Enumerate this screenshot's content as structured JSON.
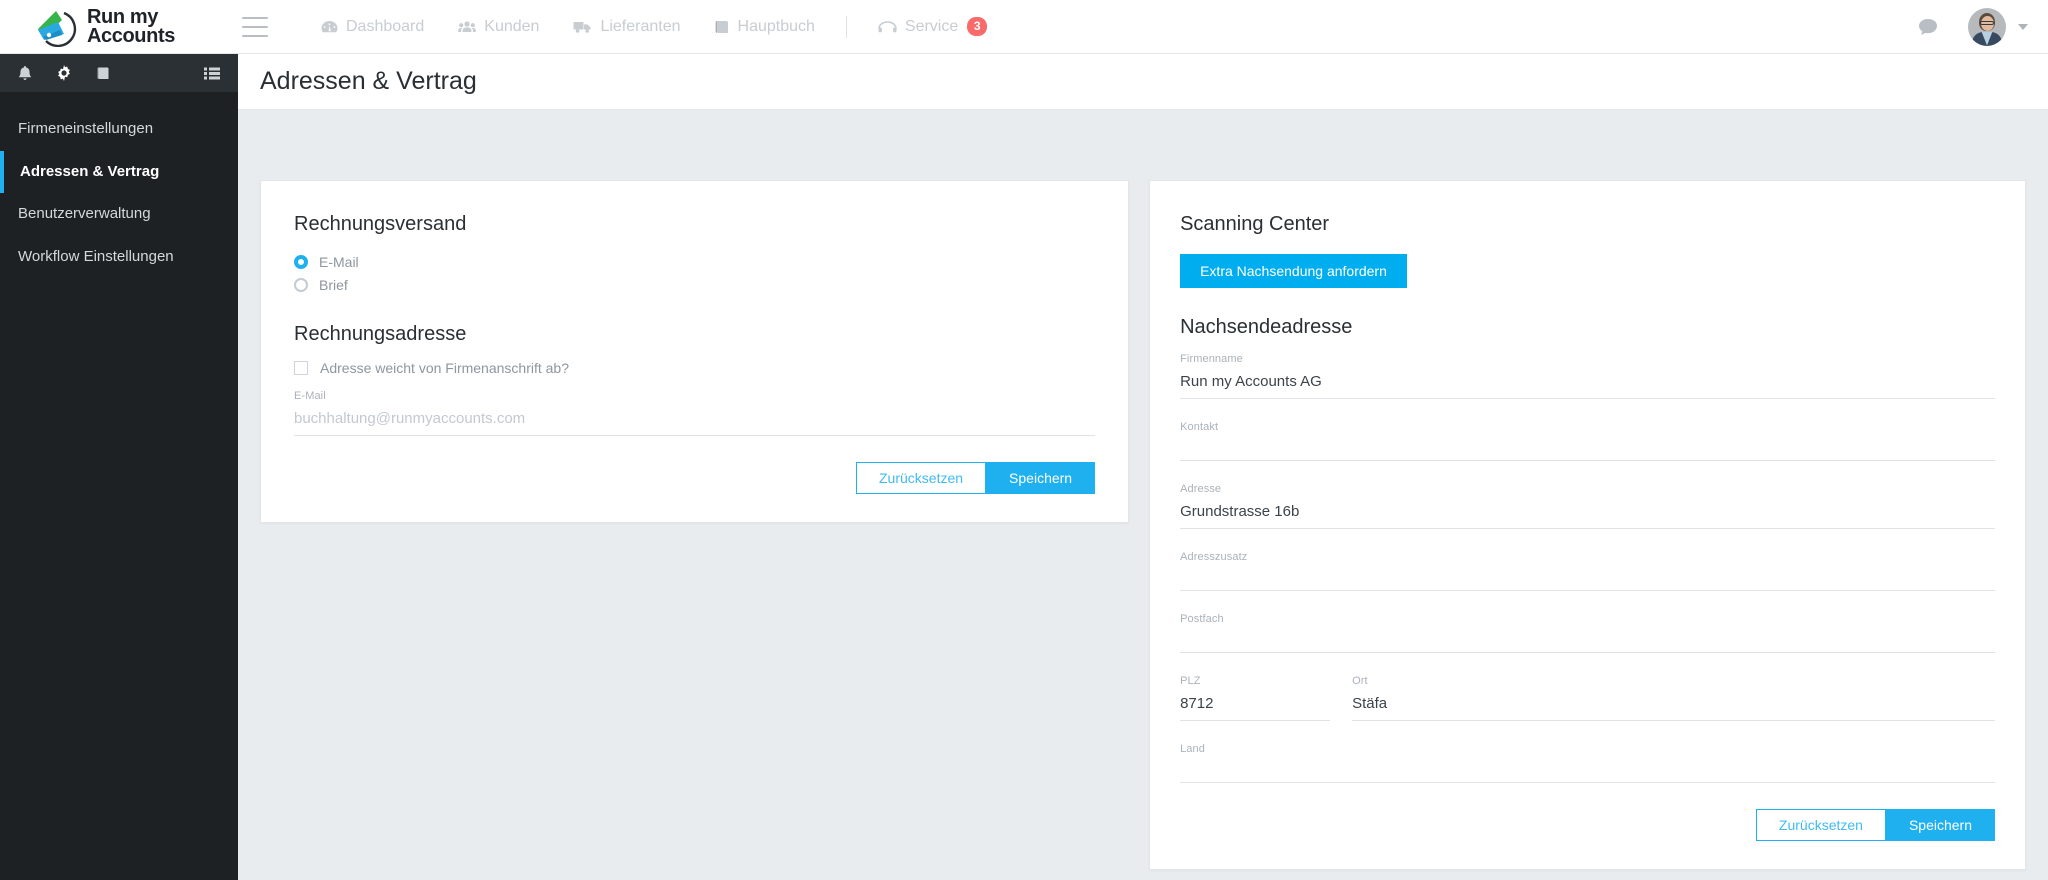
{
  "brand": {
    "line1": "Run my",
    "line2": "Accounts",
    "logo_icon": "runmyaccounts-logo-icon"
  },
  "topnav": {
    "menu_icon": "hamburger-icon",
    "items": [
      {
        "label": "Dashboard",
        "icon": "dashboard-icon",
        "badge": null
      },
      {
        "label": "Kunden",
        "icon": "customers-icon",
        "badge": null
      },
      {
        "label": "Lieferanten",
        "icon": "truck-icon",
        "badge": null
      },
      {
        "label": "Hauptbuch",
        "icon": "book-icon",
        "badge": null
      },
      {
        "label": "Service",
        "icon": "service-icon",
        "badge": "3"
      }
    ],
    "chat_icon": "chat-bubble-icon",
    "avatar_icon": "user-avatar",
    "caret_icon": "chevron-down-icon"
  },
  "sidebar": {
    "icons": [
      {
        "name": "bell-icon"
      },
      {
        "name": "gear-icon"
      },
      {
        "name": "book-icon"
      },
      {
        "name": "list-icon"
      }
    ],
    "items": [
      {
        "label": "Firmeneinstellungen",
        "active": false
      },
      {
        "label": "Adressen & Vertrag",
        "active": true
      },
      {
        "label": "Benutzerverwaltung",
        "active": false
      },
      {
        "label": "Workflow Einstellungen",
        "active": false
      }
    ]
  },
  "page": {
    "title": "Adressen & Vertrag"
  },
  "left_panel": {
    "section1_title": "Rechnungsversand",
    "radios": [
      {
        "label": "E-Mail",
        "checked": true
      },
      {
        "label": "Brief",
        "checked": false
      }
    ],
    "section2_title": "Rechnungsadresse",
    "checkbox": {
      "label": "Adresse weicht von Firmenanschrift ab?",
      "checked": false
    },
    "email_field": {
      "label": "E-Mail",
      "value": "",
      "placeholder": "buchhaltung@runmyaccounts.com"
    },
    "reset_button": "Zurücksetzen",
    "save_button": "Speichern"
  },
  "right_panel": {
    "section1_title": "Scanning Center",
    "extra_button": "Extra Nachsendung anfordern",
    "section2_title": "Nachsendeadresse",
    "fields": [
      {
        "label": "Firmenname",
        "value": "Run my Accounts AG"
      },
      {
        "label": "Kontakt",
        "value": ""
      },
      {
        "label": "Adresse",
        "value": "Grundstrasse 16b"
      },
      {
        "label": "Adresszusatz",
        "value": ""
      },
      {
        "label": "Postfach",
        "value": ""
      },
      {
        "label": "PLZ",
        "value": "8712"
      },
      {
        "label": "Ort",
        "value": "Stäfa"
      },
      {
        "label": "Land",
        "value": ""
      }
    ],
    "reset_button": "Zurücksetzen",
    "save_button": "Speichern"
  },
  "colors": {
    "accent": "#1eb0ef",
    "sidebar_bg": "#1d2124",
    "badge_red": "#f96a6a",
    "page_bg": "#e9ecee"
  }
}
